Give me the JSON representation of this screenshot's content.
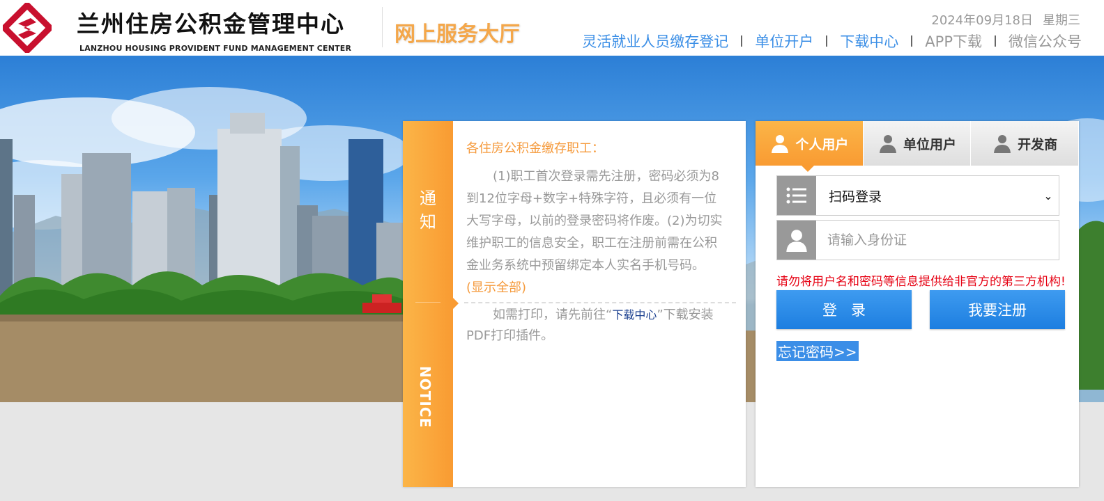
{
  "header": {
    "title_cn": "兰州住房公积金管理中心",
    "title_en": "LANZHOU HOUSING PROVIDENT FUND MANAGEMENT CENTER",
    "hall_title": "网上服务大厅",
    "date": "2024年09月18日",
    "weekday": "星期三",
    "nav": {
      "flexible_registration": "灵活就业人员缴存登记",
      "unit_open_account": "单位开户",
      "download_center": "下载中心",
      "app_download": "APP下载",
      "wechat": "微信公众号"
    }
  },
  "notice": {
    "side_label_cn_1": "通",
    "side_label_cn_2": "知",
    "side_label_en": "NOTICE",
    "headline": "各住房公积金缴存职工：",
    "paragraph1": "(1)职工首次登录需先注册，密码必须为8到12位字母+数字+特殊字符，且必须有一位大写字母，以前的登录密码将作废。(2)为切实维护职工的信息安全，职工在注册前需在公积金业务系统中预留绑定本人实名手机号码。",
    "show_all": "(显示全部)",
    "paragraph2_before": "如需打印，请先前往“",
    "paragraph2_link": "下载中心",
    "paragraph2_after": "”下载安装PDF打印插件。"
  },
  "login": {
    "tabs": [
      {
        "label": "个人用户",
        "active": true
      },
      {
        "label": "单位用户",
        "active": false
      },
      {
        "label": "开发商",
        "active": false
      }
    ],
    "method_select": "扫码登录",
    "id_placeholder": "请输入身份证",
    "warning": "请勿将用户名和密码等信息提供给非官方的第三方机构!",
    "login_button": "登录",
    "register_button": "我要注册",
    "forgot_password": "忘记密码>>"
  },
  "colors": {
    "accent_orange": "#f99b32",
    "button_blue": "#2a8ae8",
    "link_blue": "#3a8ee6",
    "warning_red": "#e60012"
  }
}
